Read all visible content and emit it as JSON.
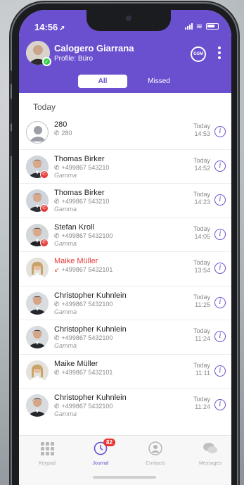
{
  "status_bar": {
    "time": "14:56",
    "gsm_label": "GSM"
  },
  "me": {
    "name": "Calogero Giarrana",
    "profile": "Profile: Büro"
  },
  "filter_tabs": {
    "all": "All",
    "missed": "Missed"
  },
  "section": "Today",
  "calls": [
    {
      "name": "280",
      "number": "280",
      "sub": "",
      "day": "Today",
      "time": "14:53",
      "missed": false,
      "avatar": "placeholder",
      "badge": false
    },
    {
      "name": "Thomas Birker",
      "number": "+499867 543210",
      "sub": "Gamma",
      "day": "Today",
      "time": "14:52",
      "missed": false,
      "avatar": "thomas",
      "badge": true
    },
    {
      "name": "Thomas Birker",
      "number": "+499867 543210",
      "sub": "Gamma",
      "day": "Today",
      "time": "14:23",
      "missed": false,
      "avatar": "thomas",
      "badge": true
    },
    {
      "name": "Stefan Kroll",
      "number": "+499867 5432100",
      "sub": "Gamma",
      "day": "Today",
      "time": "14:05",
      "missed": false,
      "avatar": "stefan",
      "badge": true
    },
    {
      "name": "Maike Müller",
      "number": "+499867 5432101",
      "sub": "",
      "day": "Today",
      "time": "13:54",
      "missed": true,
      "avatar": "maike",
      "badge": false
    },
    {
      "name": "Christopher Kuhnlein",
      "number": "+499867 5432100",
      "sub": "Gamma",
      "day": "Today",
      "time": "11:25",
      "missed": false,
      "avatar": "christopher",
      "badge": false
    },
    {
      "name": "Christopher Kuhnlein",
      "number": "+499867 5432100",
      "sub": "Gamma",
      "day": "Today",
      "time": "11:24",
      "missed": false,
      "avatar": "christopher",
      "badge": false
    },
    {
      "name": "Maike Müller",
      "number": "+499867 5432101",
      "sub": "",
      "day": "Today",
      "time": "11:11",
      "missed": false,
      "avatar": "maike",
      "badge": false
    },
    {
      "name": "Christopher Kuhnlein",
      "number": "+499867 5432100",
      "sub": "Gamma",
      "day": "Today",
      "time": "11:24",
      "missed": false,
      "avatar": "christopher",
      "badge": false
    }
  ],
  "tabbar": {
    "keypad": "Keypad",
    "journal": "Journal",
    "journal_badge": "82",
    "contacts": "Contacts",
    "messages": "Messages"
  },
  "colors": {
    "accent": "#6a4fcf",
    "missed": "#e53935",
    "online": "#2ecc40"
  }
}
